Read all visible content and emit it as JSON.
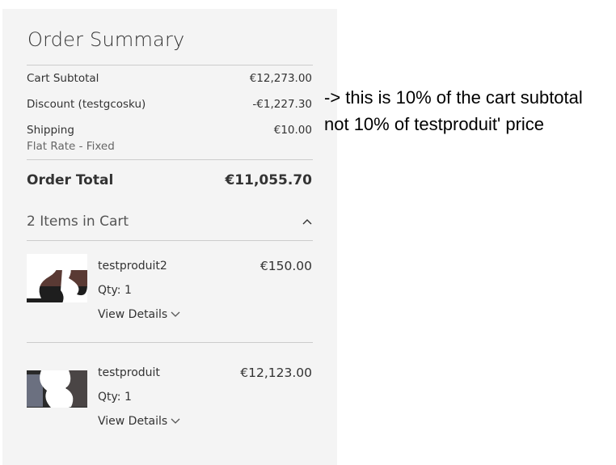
{
  "summary": {
    "title": "Order Summary",
    "cart_subtotal_label": "Cart Subtotal",
    "cart_subtotal_value": "€12,273.00",
    "discount_label": "Discount (testgcosku)",
    "discount_value": "-€1,227.30",
    "shipping_label": "Shipping",
    "shipping_method": "Flat Rate - Fixed",
    "shipping_value": "€10.00",
    "order_total_label": "Order Total",
    "order_total_value": "€11,055.70"
  },
  "cart": {
    "items_header": "2 Items in Cart",
    "items": [
      {
        "name": "testproduit2",
        "price": "€150.00",
        "qty": "Qty: 1",
        "details": "View Details"
      },
      {
        "name": "testproduit",
        "price": "€12,123.00",
        "qty": "Qty: 1",
        "details": "View Details"
      }
    ]
  },
  "annotation": {
    "line1": "-> this is 10% of the cart subtotal",
    "line2": "not 10% of testproduit' price"
  }
}
